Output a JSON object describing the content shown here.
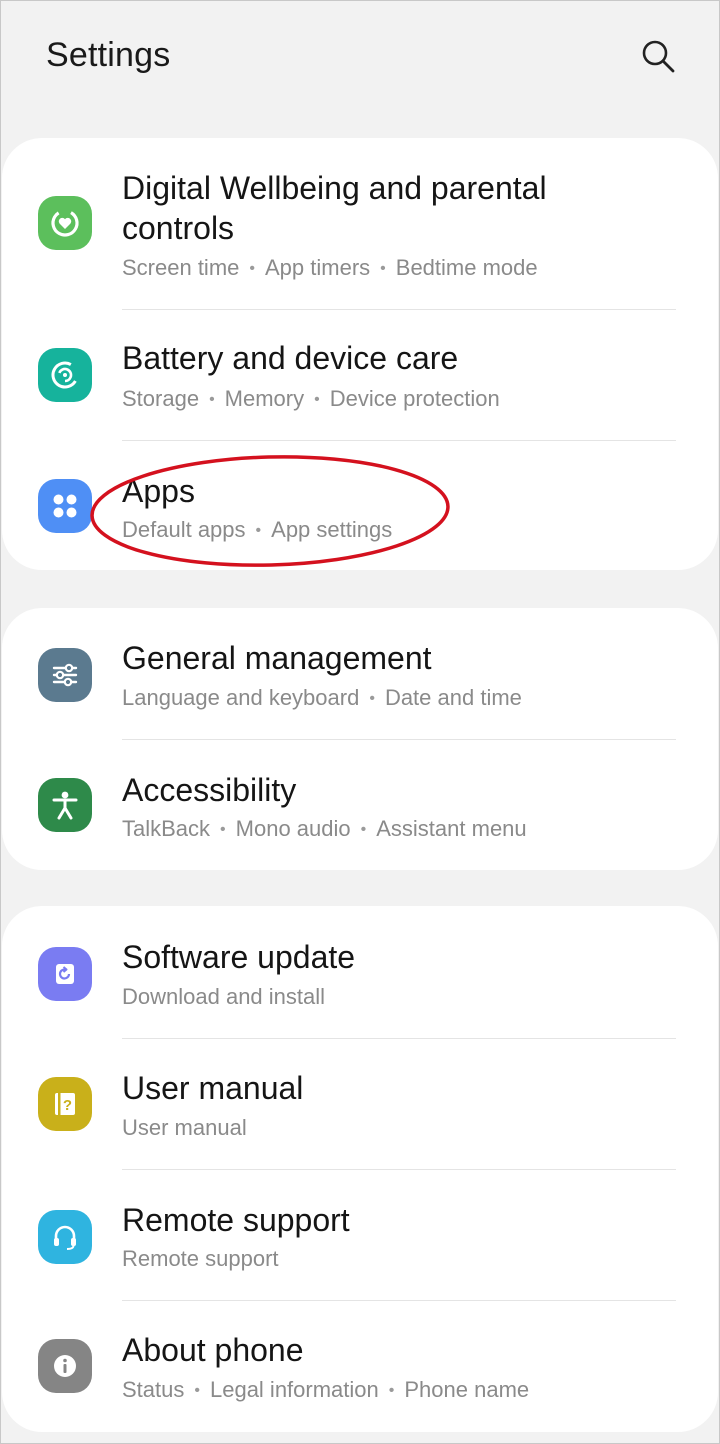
{
  "header": {
    "title": "Settings",
    "search_icon": "search-icon"
  },
  "groups": [
    {
      "items": [
        {
          "id": "digital-wellbeing",
          "title_line1": "Digital Wellbeing and parental",
          "title_line2": "controls",
          "subs": [
            "Screen time",
            "App timers",
            "Bedtime mode"
          ],
          "icon": "wellbeing-icon",
          "color": "#5cbf5c"
        },
        {
          "id": "battery",
          "title": "Battery and device care",
          "subs": [
            "Storage",
            "Memory",
            "Device protection"
          ],
          "icon": "device-care-icon",
          "color": "#16b39c"
        },
        {
          "id": "apps",
          "title": "Apps",
          "subs": [
            "Default apps",
            "App settings"
          ],
          "icon": "apps-icon",
          "color": "#4f8ff5"
        }
      ]
    },
    {
      "items": [
        {
          "id": "general-management",
          "title": "General management",
          "subs": [
            "Language and keyboard",
            "Date and time"
          ],
          "icon": "sliders-icon",
          "color": "#5b7a8f"
        },
        {
          "id": "accessibility",
          "title": "Accessibility",
          "subs": [
            "TalkBack",
            "Mono audio",
            "Assistant menu"
          ],
          "icon": "accessibility-icon",
          "color": "#2e8a4a"
        }
      ]
    },
    {
      "items": [
        {
          "id": "software-update",
          "title": "Software update",
          "subs": [
            "Download and install"
          ],
          "icon": "update-icon",
          "color": "#7a7cf2"
        },
        {
          "id": "user-manual",
          "title": "User manual",
          "subs": [
            "User manual"
          ],
          "icon": "manual-icon",
          "color": "#c9b01a"
        },
        {
          "id": "remote-support",
          "title": "Remote support",
          "subs": [
            "Remote support"
          ],
          "icon": "headset-icon",
          "color": "#2fb4e0"
        },
        {
          "id": "about-phone",
          "title": "About phone",
          "subs": [
            "Status",
            "Legal information",
            "Phone name"
          ],
          "icon": "info-icon",
          "color": "#858585"
        }
      ]
    }
  ],
  "annotation": {
    "color": "#d4111e",
    "target": "apps"
  }
}
